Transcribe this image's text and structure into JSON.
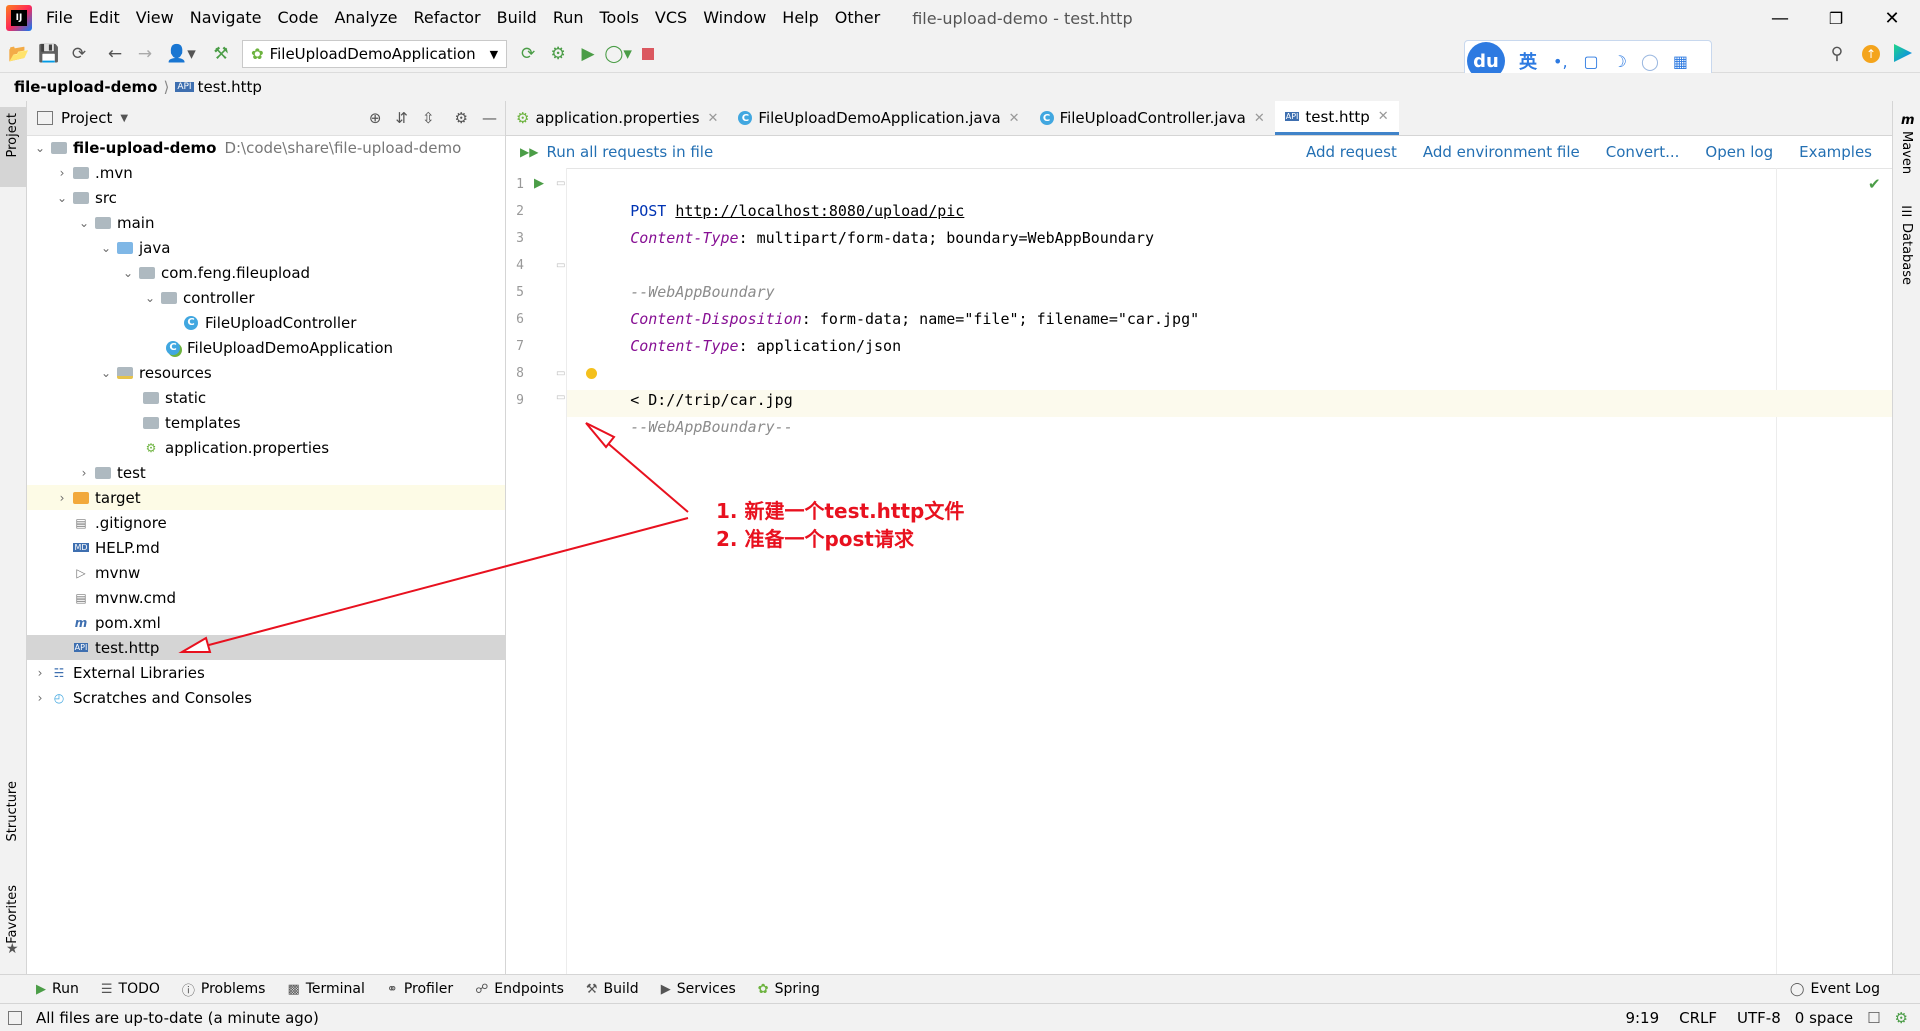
{
  "menubar": {
    "items": [
      "File",
      "Edit",
      "View",
      "Navigate",
      "Code",
      "Analyze",
      "Refactor",
      "Build",
      "Run",
      "Tools",
      "VCS",
      "Window",
      "Help",
      "Other"
    ],
    "window_title": "file-upload-demo - test.http"
  },
  "toolbar": {
    "run_config": "FileUploadDemoApplication"
  },
  "ime": {
    "logo": "du",
    "lang": "英"
  },
  "breadcrumb": {
    "project": "file-upload-demo",
    "file": "test.http"
  },
  "left_stripe": {
    "project": "Project",
    "structure": "Structure",
    "favorites": "Favorites"
  },
  "right_stripe": {
    "maven": "Maven",
    "database": "Database"
  },
  "project_panel": {
    "title": "Project",
    "tree": [
      {
        "label": "file-upload-demo",
        "path": "D:\\code\\share\\file-upload-demo"
      },
      {
        "label": ".mvn"
      },
      {
        "label": "src"
      },
      {
        "label": "main"
      },
      {
        "label": "java"
      },
      {
        "label": "com.feng.fileupload"
      },
      {
        "label": "controller"
      },
      {
        "label": "FileUploadController"
      },
      {
        "label": "FileUploadDemoApplication"
      },
      {
        "label": "resources"
      },
      {
        "label": "static"
      },
      {
        "label": "templates"
      },
      {
        "label": "application.properties"
      },
      {
        "label": "test"
      },
      {
        "label": "target"
      },
      {
        "label": ".gitignore"
      },
      {
        "label": "HELP.md"
      },
      {
        "label": "mvnw"
      },
      {
        "label": "mvnw.cmd"
      },
      {
        "label": "pom.xml"
      },
      {
        "label": "test.http"
      },
      {
        "label": "External Libraries"
      },
      {
        "label": "Scratches and Consoles"
      }
    ]
  },
  "tabs": [
    {
      "label": "application.properties"
    },
    {
      "label": "FileUploadDemoApplication.java"
    },
    {
      "label": "FileUploadController.java"
    },
    {
      "label": "test.http"
    }
  ],
  "http_toolbar": {
    "run_all": "Run all requests in file",
    "add_request": "Add request",
    "add_env": "Add environment file",
    "convert": "Convert...",
    "open_log": "Open log",
    "examples": "Examples"
  },
  "editor": {
    "line_numbers": [
      "1",
      "2",
      "3",
      "4",
      "5",
      "6",
      "7",
      "8",
      "9"
    ],
    "line1": {
      "method": "POST",
      "url": "http://localhost:8080/upload/pic"
    },
    "line2": {
      "name": "Content-Type",
      "value": ": multipart/form-data; boundary=WebAppBoundary"
    },
    "line4": "--WebAppBoundary",
    "line5": {
      "name": "Content-Disposition",
      "value": ": form-data; name=\"file\"; filename=\"car.jpg\""
    },
    "line6": {
      "name": "Content-Type",
      "value": ": application/json"
    },
    "line8": "< D://trip/car.jpg",
    "line9": "--WebAppBoundary--"
  },
  "annotation": {
    "line1": "1. 新建一个test.http文件",
    "line2": "2. 准备一个post请求"
  },
  "bottom_tools": [
    "Run",
    "TODO",
    "Problems",
    "Terminal",
    "Profiler",
    "Endpoints",
    "Build",
    "Services",
    "Spring"
  ],
  "event_log": "Event Log",
  "status": {
    "message": "All files are up-to-date (a minute ago)",
    "position": "9:19",
    "line_sep": "CRLF",
    "encoding": "UTF-8",
    "indent": "0 space"
  },
  "colors": {
    "accent": "#4083c9",
    "link": "#2470b3",
    "annotation": "#e8111f",
    "selection": "#d5d5d5"
  }
}
